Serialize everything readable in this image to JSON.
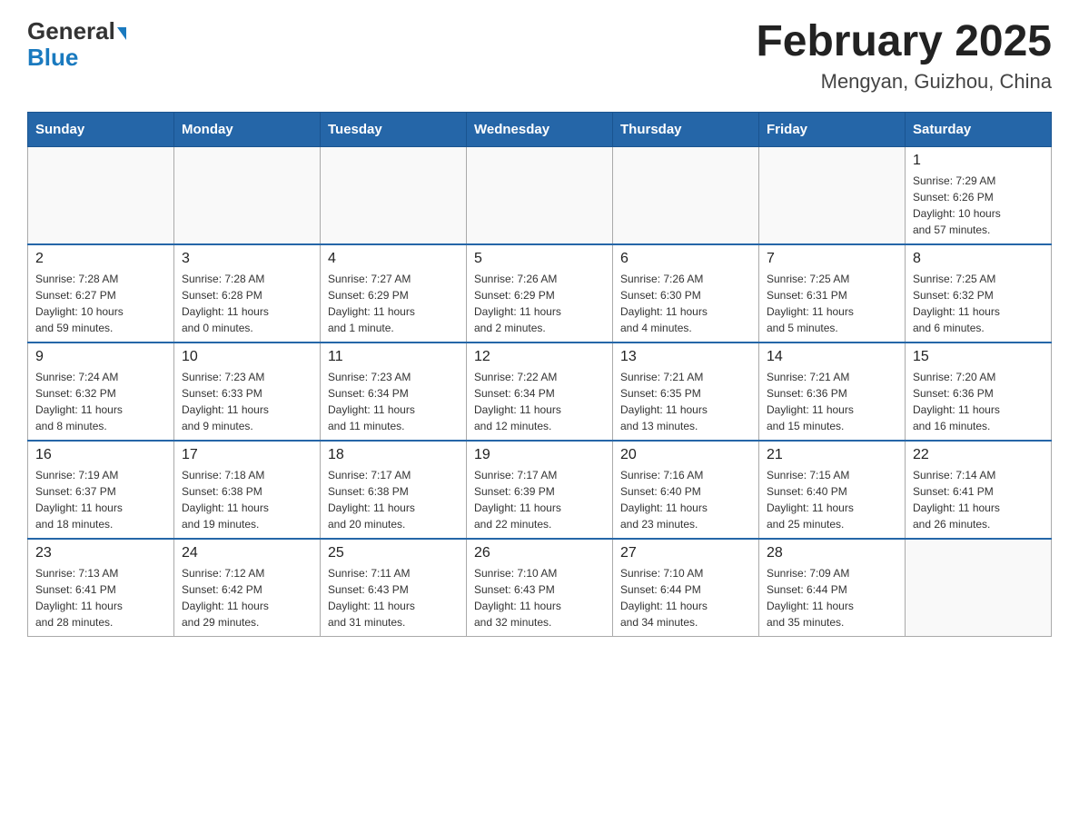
{
  "logo": {
    "general": "General",
    "blue": "Blue"
  },
  "title": "February 2025",
  "subtitle": "Mengyan, Guizhou, China",
  "days_of_week": [
    "Sunday",
    "Monday",
    "Tuesday",
    "Wednesday",
    "Thursday",
    "Friday",
    "Saturday"
  ],
  "weeks": [
    [
      {
        "day": "",
        "info": ""
      },
      {
        "day": "",
        "info": ""
      },
      {
        "day": "",
        "info": ""
      },
      {
        "day": "",
        "info": ""
      },
      {
        "day": "",
        "info": ""
      },
      {
        "day": "",
        "info": ""
      },
      {
        "day": "1",
        "info": "Sunrise: 7:29 AM\nSunset: 6:26 PM\nDaylight: 10 hours\nand 57 minutes."
      }
    ],
    [
      {
        "day": "2",
        "info": "Sunrise: 7:28 AM\nSunset: 6:27 PM\nDaylight: 10 hours\nand 59 minutes."
      },
      {
        "day": "3",
        "info": "Sunrise: 7:28 AM\nSunset: 6:28 PM\nDaylight: 11 hours\nand 0 minutes."
      },
      {
        "day": "4",
        "info": "Sunrise: 7:27 AM\nSunset: 6:29 PM\nDaylight: 11 hours\nand 1 minute."
      },
      {
        "day": "5",
        "info": "Sunrise: 7:26 AM\nSunset: 6:29 PM\nDaylight: 11 hours\nand 2 minutes."
      },
      {
        "day": "6",
        "info": "Sunrise: 7:26 AM\nSunset: 6:30 PM\nDaylight: 11 hours\nand 4 minutes."
      },
      {
        "day": "7",
        "info": "Sunrise: 7:25 AM\nSunset: 6:31 PM\nDaylight: 11 hours\nand 5 minutes."
      },
      {
        "day": "8",
        "info": "Sunrise: 7:25 AM\nSunset: 6:32 PM\nDaylight: 11 hours\nand 6 minutes."
      }
    ],
    [
      {
        "day": "9",
        "info": "Sunrise: 7:24 AM\nSunset: 6:32 PM\nDaylight: 11 hours\nand 8 minutes."
      },
      {
        "day": "10",
        "info": "Sunrise: 7:23 AM\nSunset: 6:33 PM\nDaylight: 11 hours\nand 9 minutes."
      },
      {
        "day": "11",
        "info": "Sunrise: 7:23 AM\nSunset: 6:34 PM\nDaylight: 11 hours\nand 11 minutes."
      },
      {
        "day": "12",
        "info": "Sunrise: 7:22 AM\nSunset: 6:34 PM\nDaylight: 11 hours\nand 12 minutes."
      },
      {
        "day": "13",
        "info": "Sunrise: 7:21 AM\nSunset: 6:35 PM\nDaylight: 11 hours\nand 13 minutes."
      },
      {
        "day": "14",
        "info": "Sunrise: 7:21 AM\nSunset: 6:36 PM\nDaylight: 11 hours\nand 15 minutes."
      },
      {
        "day": "15",
        "info": "Sunrise: 7:20 AM\nSunset: 6:36 PM\nDaylight: 11 hours\nand 16 minutes."
      }
    ],
    [
      {
        "day": "16",
        "info": "Sunrise: 7:19 AM\nSunset: 6:37 PM\nDaylight: 11 hours\nand 18 minutes."
      },
      {
        "day": "17",
        "info": "Sunrise: 7:18 AM\nSunset: 6:38 PM\nDaylight: 11 hours\nand 19 minutes."
      },
      {
        "day": "18",
        "info": "Sunrise: 7:17 AM\nSunset: 6:38 PM\nDaylight: 11 hours\nand 20 minutes."
      },
      {
        "day": "19",
        "info": "Sunrise: 7:17 AM\nSunset: 6:39 PM\nDaylight: 11 hours\nand 22 minutes."
      },
      {
        "day": "20",
        "info": "Sunrise: 7:16 AM\nSunset: 6:40 PM\nDaylight: 11 hours\nand 23 minutes."
      },
      {
        "day": "21",
        "info": "Sunrise: 7:15 AM\nSunset: 6:40 PM\nDaylight: 11 hours\nand 25 minutes."
      },
      {
        "day": "22",
        "info": "Sunrise: 7:14 AM\nSunset: 6:41 PM\nDaylight: 11 hours\nand 26 minutes."
      }
    ],
    [
      {
        "day": "23",
        "info": "Sunrise: 7:13 AM\nSunset: 6:41 PM\nDaylight: 11 hours\nand 28 minutes."
      },
      {
        "day": "24",
        "info": "Sunrise: 7:12 AM\nSunset: 6:42 PM\nDaylight: 11 hours\nand 29 minutes."
      },
      {
        "day": "25",
        "info": "Sunrise: 7:11 AM\nSunset: 6:43 PM\nDaylight: 11 hours\nand 31 minutes."
      },
      {
        "day": "26",
        "info": "Sunrise: 7:10 AM\nSunset: 6:43 PM\nDaylight: 11 hours\nand 32 minutes."
      },
      {
        "day": "27",
        "info": "Sunrise: 7:10 AM\nSunset: 6:44 PM\nDaylight: 11 hours\nand 34 minutes."
      },
      {
        "day": "28",
        "info": "Sunrise: 7:09 AM\nSunset: 6:44 PM\nDaylight: 11 hours\nand 35 minutes."
      },
      {
        "day": "",
        "info": ""
      }
    ]
  ]
}
